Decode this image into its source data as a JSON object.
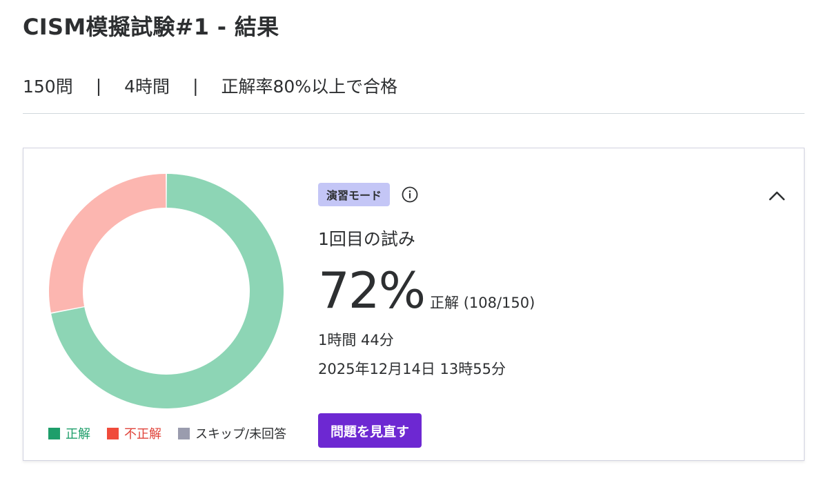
{
  "header": {
    "title": "CISM模擬試験#1 - 結果",
    "question_count": "150問",
    "duration": "4時間",
    "pass_criteria": "正解率80%以上で合格",
    "separator": "|"
  },
  "result_card": {
    "mode_badge": "演習モード",
    "info_icon": "info-icon",
    "collapse_icon": "chevron-up-icon",
    "attempt_label": "1回目の試み",
    "score_percent": "72%",
    "score_detail": "正解 (108/150)",
    "time_taken": "1時間 44分",
    "completed_at": "2025年12月14日 13時55分",
    "review_button": "問題を見直す"
  },
  "chart_data": {
    "type": "pie",
    "total": 150,
    "series": [
      {
        "name": "正解",
        "value": 108,
        "color": "#8dd5b5"
      },
      {
        "name": "不正解",
        "value": 42,
        "color": "#fcb6b0"
      },
      {
        "name": "スキップ/未回答",
        "value": 0,
        "color": "#9a9cae"
      }
    ]
  },
  "legend": [
    {
      "label": "正解",
      "swatch_color": "#1e9e6a",
      "text_color": "#1e9e6a"
    },
    {
      "label": "不正解",
      "swatch_color": "#f04b3b",
      "text_color": "#e0433a"
    },
    {
      "label": "スキップ/未回答",
      "swatch_color": "#9a9cae",
      "text_color": "#2d2f31"
    }
  ],
  "colors": {
    "accent": "#6d28d2",
    "badge_bg": "#c4c6f6"
  }
}
